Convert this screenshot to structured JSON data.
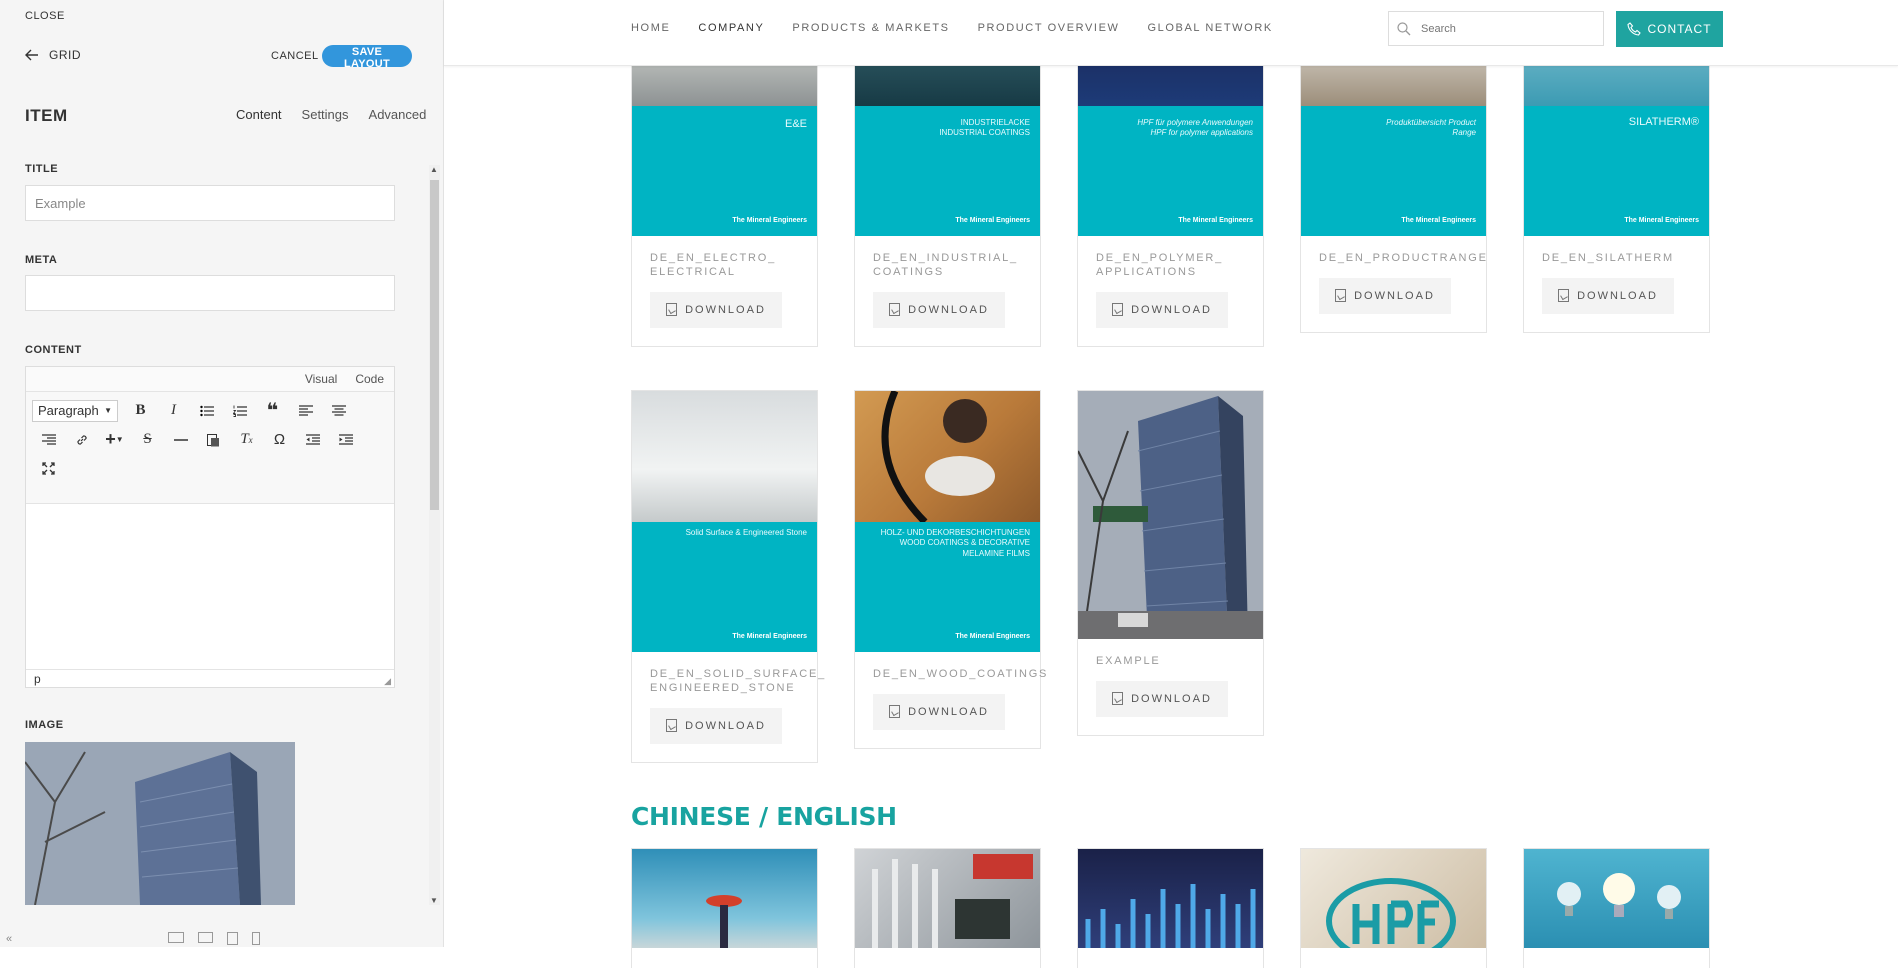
{
  "panel": {
    "close_label": "CLOSE",
    "back_label": "GRID",
    "cancel_label": "CANCEL",
    "save_label": "SAVE LAYOUT",
    "item_heading": "ITEM",
    "tabs": [
      "Content",
      "Settings",
      "Advanced"
    ],
    "title_label": "TITLE",
    "title_value": "Example",
    "meta_label": "META",
    "meta_value": "",
    "content_label": "CONTENT",
    "editor_modes": [
      "Visual",
      "Code"
    ],
    "format_select": "Paragraph",
    "editor_path": "p",
    "image_label": "IMAGE"
  },
  "header": {
    "nav": [
      "HOME",
      "COMPANY",
      "PRODUCTS & MARKETS",
      "PRODUCT OVERVIEW",
      "GLOBAL NETWORK"
    ],
    "active_nav": "COMPANY",
    "search_placeholder": "Search",
    "contact_label": "CONTACT"
  },
  "accent_color": "#1fa4a0",
  "brochure_color": "#00b4c3",
  "download_label": "DOWNLOAD",
  "cards_row1": [
    {
      "name": "DE_EN_ELECTRO_ ELECTRICAL",
      "cover_title": "E&E"
    },
    {
      "name": "DE_EN_INDUSTRIAL_ COATINGS",
      "cover_title": "INDUSTRIELACKE INDUSTRIAL COATINGS"
    },
    {
      "name": "DE_EN_POLYMER_ APPLICATIONS",
      "cover_title": "HPF für polymere Anwendungen HPF for polymer applications"
    },
    {
      "name": "DE_EN_PRODUCTRANGE",
      "cover_title": "Produktübersicht Product Range"
    },
    {
      "name": "DE_EN_SILATHERM",
      "cover_title": "SILATHERM®"
    }
  ],
  "cards_row2": [
    {
      "name": "DE_EN_SOLID_SURFACE_ ENGINEERED_STONE",
      "cover_title": "Solid Surface & Engineered Stone"
    },
    {
      "name": "DE_EN_WOOD_COATINGS",
      "cover_title": "HOLZ- UND DEKORBESCHICHTUNGEN WOOD COATINGS & DECORATIVE MELAMINE FILMS"
    },
    {
      "name": "EXAMPLE",
      "cover_title": ""
    }
  ],
  "brand_text": "The Mineral Engineers",
  "section_heading": "CHINESE / ENGLISH"
}
